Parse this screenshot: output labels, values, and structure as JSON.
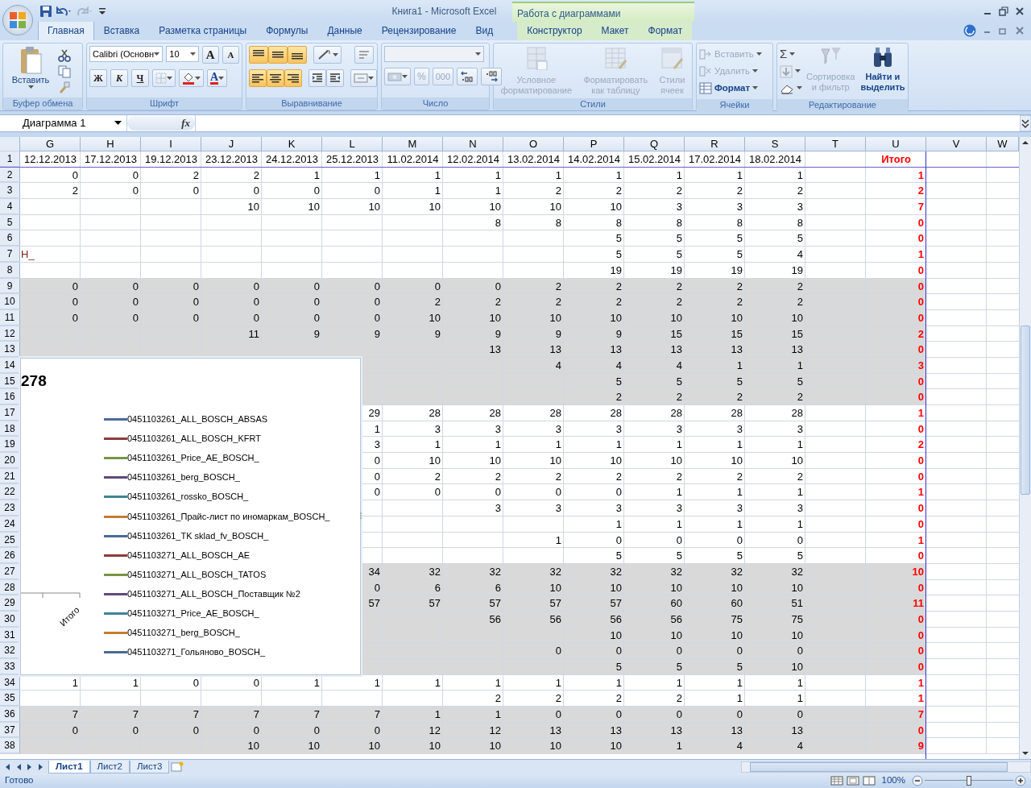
{
  "window": {
    "title": "Книга1 - Microsoft Excel",
    "context_title": "Работа с диаграммами"
  },
  "quick_access": [
    {
      "kind": "save",
      "disabled": false
    },
    {
      "kind": "undo",
      "disabled": false
    },
    {
      "kind": "redo",
      "disabled": true
    }
  ],
  "tabs": [
    {
      "label": "Главная",
      "selected": true,
      "context": false
    },
    {
      "label": "Вставка",
      "selected": false,
      "context": false
    },
    {
      "label": "Разметка страницы",
      "selected": false,
      "context": false
    },
    {
      "label": "Формулы",
      "selected": false,
      "context": false
    },
    {
      "label": "Данные",
      "selected": false,
      "context": false
    },
    {
      "label": "Рецензирование",
      "selected": false,
      "context": false
    },
    {
      "label": "Вид",
      "selected": false,
      "context": false
    },
    {
      "label": "Конструктор",
      "selected": false,
      "context": true
    },
    {
      "label": "Макет",
      "selected": false,
      "context": true
    },
    {
      "label": "Формат",
      "selected": false,
      "context": true
    }
  ],
  "ribbon": {
    "clipboard": {
      "label": "Буфер обмена",
      "paste": "Вставить"
    },
    "font": {
      "label": "Шрифт",
      "name": "Calibri (Основн",
      "size": "10",
      "grow": "A",
      "shrink": "A",
      "bold": "Ж",
      "italic": "К",
      "underline": "Ч",
      "color_letter": "A"
    },
    "alignment": {
      "label": "Выравнивание",
      "buttons": [
        {
          "kind": "top",
          "on": true
        },
        {
          "kind": "middle",
          "on": true
        },
        {
          "kind": "bottom",
          "on": true
        },
        {
          "kind": "left",
          "on": true
        },
        {
          "kind": "center",
          "on": true
        },
        {
          "kind": "right",
          "on": true
        }
      ]
    },
    "number": {
      "label": "Число",
      "percent": "%",
      "thousands": "000"
    },
    "styles": {
      "label": "Стили",
      "buttons": [
        {
          "kind": "conditional",
          "lines": [
            "Условное",
            "форматирование"
          ],
          "disabled": true
        },
        {
          "kind": "table",
          "lines": [
            "Форматировать",
            "как таблицу"
          ],
          "disabled": true
        },
        {
          "kind": "cellstyles",
          "lines": [
            "Стили",
            "ячеек"
          ],
          "disabled": true
        }
      ]
    },
    "cells": {
      "label": "Ячейки",
      "buttons": [
        {
          "kind": "insert",
          "label": "Вставить",
          "disabled": true
        },
        {
          "kind": "delete",
          "label": "Удалить",
          "disabled": true
        },
        {
          "kind": "format",
          "label": "Формат",
          "disabled": false
        }
      ]
    },
    "editing": {
      "label": "Редактирование",
      "sum": "Σ",
      "buttons": [
        {
          "kind": "sort",
          "lines": [
            "Сортировка",
            "и фильтр"
          ],
          "disabled": true
        },
        {
          "kind": "find",
          "lines": [
            "Найти и",
            "выделить"
          ],
          "disabled": false
        }
      ]
    }
  },
  "formula_bar": {
    "name_box": "Диаграмма 1",
    "function_label": "fx"
  },
  "sheet": {
    "columns": [
      {
        "label": "G",
        "kind": "data"
      },
      {
        "label": "H",
        "kind": "data"
      },
      {
        "label": "I",
        "kind": "data"
      },
      {
        "label": "J",
        "kind": "data"
      },
      {
        "label": "K",
        "kind": "data"
      },
      {
        "label": "L",
        "kind": "data"
      },
      {
        "label": "M",
        "kind": "data"
      },
      {
        "label": "N",
        "kind": "data"
      },
      {
        "label": "O",
        "kind": "data"
      },
      {
        "label": "P",
        "kind": "data"
      },
      {
        "label": "Q",
        "kind": "data"
      },
      {
        "label": "R",
        "kind": "data"
      },
      {
        "label": "S",
        "kind": "data"
      },
      {
        "label": "T",
        "kind": "data"
      },
      {
        "label": "U",
        "kind": "total"
      },
      {
        "label": "V",
        "kind": "data"
      },
      {
        "label": "W",
        "kind": "partial"
      }
    ],
    "rows": [
      {
        "number": "1",
        "kind": "dates",
        "shaded": false,
        "cells": [
          "12.12.2013",
          "17.12.2013",
          "19.12.2013",
          "23.12.2013",
          "24.12.2013",
          "25.12.2013",
          "11.02.2014",
          "12.02.2014",
          "13.02.2014",
          "14.02.2014",
          "15.02.2014",
          "17.02.2014",
          "18.02.2014",
          null,
          "Итого"
        ]
      },
      {
        "number": "2",
        "kind": "data",
        "shaded": false,
        "cells": [
          "0",
          "0",
          "2",
          "2",
          "1",
          "1",
          "1",
          "1",
          "1",
          "1",
          "1",
          "1",
          "1",
          null,
          "1"
        ]
      },
      {
        "number": "3",
        "kind": "data",
        "shaded": false,
        "cells": [
          "2",
          "0",
          "0",
          "0",
          "0",
          "0",
          "1",
          "1",
          "2",
          "2",
          "2",
          "2",
          "2",
          null,
          "2"
        ]
      },
      {
        "number": "4",
        "kind": "data",
        "shaded": false,
        "cells": [
          null,
          null,
          null,
          "10",
          "10",
          "10",
          "10",
          "10",
          "10",
          "10",
          "3",
          "3",
          "3",
          null,
          "7"
        ]
      },
      {
        "number": "5",
        "kind": "data",
        "shaded": false,
        "cells": [
          null,
          null,
          null,
          null,
          null,
          null,
          null,
          "8",
          "8",
          "8",
          "8",
          "8",
          "8",
          null,
          "0"
        ]
      },
      {
        "number": "6",
        "kind": "data",
        "shaded": false,
        "cells": [
          null,
          null,
          null,
          null,
          null,
          null,
          null,
          null,
          null,
          "5",
          "5",
          "5",
          "5",
          null,
          "0"
        ]
      },
      {
        "number": "7",
        "kind": "data",
        "shaded": false,
        "cells": [
          {
            "text": "Н_",
            "kind": "text"
          },
          null,
          null,
          null,
          null,
          null,
          null,
          null,
          null,
          "5",
          "5",
          "5",
          "4",
          null,
          "1"
        ]
      },
      {
        "number": "8",
        "kind": "data",
        "shaded": false,
        "cells": [
          null,
          null,
          null,
          null,
          null,
          null,
          null,
          null,
          null,
          "19",
          "19",
          "19",
          "19",
          null,
          "0"
        ]
      },
      {
        "number": "9",
        "kind": "data",
        "shaded": true,
        "cells": [
          "0",
          "0",
          "0",
          "0",
          "0",
          "0",
          "0",
          "0",
          "2",
          "2",
          "2",
          "2",
          "2",
          null,
          "0"
        ]
      },
      {
        "number": "10",
        "kind": "data",
        "shaded": true,
        "cells": [
          "0",
          "0",
          "0",
          "0",
          "0",
          "0",
          "2",
          "2",
          "2",
          "2",
          "2",
          "2",
          "2",
          null,
          "0"
        ]
      },
      {
        "number": "11",
        "kind": "data",
        "shaded": true,
        "cells": [
          "0",
          "0",
          "0",
          "0",
          "0",
          "0",
          "10",
          "10",
          "10",
          "10",
          "10",
          "10",
          "10",
          null,
          "0"
        ]
      },
      {
        "number": "12",
        "kind": "data",
        "shaded": true,
        "cells": [
          null,
          null,
          null,
          "11",
          "9",
          "9",
          "9",
          "9",
          "9",
          "9",
          "15",
          "15",
          "15",
          null,
          "2"
        ]
      },
      {
        "number": "13",
        "kind": "data",
        "shaded": true,
        "cells": [
          null,
          null,
          null,
          null,
          null,
          null,
          null,
          "13",
          "13",
          "13",
          "13",
          "13",
          "13",
          null,
          "0"
        ]
      },
      {
        "number": "14",
        "kind": "data",
        "shaded": true,
        "cells": [
          null,
          null,
          null,
          null,
          null,
          null,
          null,
          null,
          "4",
          "4",
          "4",
          "1",
          "1",
          null,
          "3"
        ]
      },
      {
        "number": "15",
        "kind": "data",
        "shaded": true,
        "cells": [
          null,
          null,
          null,
          null,
          null,
          null,
          null,
          null,
          null,
          "5",
          "5",
          "5",
          "5",
          null,
          "0"
        ]
      },
      {
        "number": "16",
        "kind": "data",
        "shaded": true,
        "cells": [
          null,
          null,
          null,
          null,
          null,
          null,
          null,
          null,
          null,
          "2",
          "2",
          "2",
          "2",
          null,
          "0"
        ]
      },
      {
        "number": "17",
        "kind": "data",
        "shaded": false,
        "cells": [
          null,
          null,
          null,
          null,
          null,
          "29",
          "28",
          "28",
          "28",
          "28",
          "28",
          "28",
          "28",
          null,
          "1"
        ]
      },
      {
        "number": "18",
        "kind": "data",
        "shaded": false,
        "cells": [
          null,
          null,
          null,
          null,
          null,
          "1",
          "3",
          "3",
          "3",
          "3",
          "3",
          "3",
          "3",
          null,
          "0"
        ]
      },
      {
        "number": "19",
        "kind": "data",
        "shaded": false,
        "cells": [
          null,
          null,
          null,
          null,
          null,
          "3",
          "1",
          "1",
          "1",
          "1",
          "1",
          "1",
          "1",
          null,
          "2"
        ]
      },
      {
        "number": "20",
        "kind": "data",
        "shaded": false,
        "cells": [
          null,
          null,
          null,
          null,
          null,
          "0",
          "10",
          "10",
          "10",
          "10",
          "10",
          "10",
          "10",
          null,
          "0"
        ]
      },
      {
        "number": "21",
        "kind": "data",
        "shaded": false,
        "cells": [
          null,
          null,
          null,
          null,
          null,
          "0",
          "2",
          "2",
          "2",
          "2",
          "2",
          "2",
          "2",
          null,
          "0"
        ]
      },
      {
        "number": "22",
        "kind": "data",
        "shaded": false,
        "cells": [
          null,
          null,
          null,
          null,
          null,
          "0",
          "0",
          "0",
          "0",
          "0",
          "1",
          "1",
          "1",
          null,
          "1"
        ]
      },
      {
        "number": "23",
        "kind": "data",
        "shaded": false,
        "cells": [
          null,
          null,
          null,
          null,
          null,
          null,
          null,
          "3",
          "3",
          "3",
          "3",
          "3",
          "3",
          null,
          "0"
        ]
      },
      {
        "number": "24",
        "kind": "data",
        "shaded": false,
        "cells": [
          null,
          null,
          null,
          null,
          null,
          null,
          null,
          null,
          null,
          "1",
          "1",
          "1",
          "1",
          null,
          "0"
        ]
      },
      {
        "number": "25",
        "kind": "data",
        "shaded": false,
        "cells": [
          null,
          null,
          null,
          null,
          null,
          null,
          null,
          null,
          "1",
          "0",
          "0",
          "0",
          "0",
          null,
          "1"
        ]
      },
      {
        "number": "26",
        "kind": "data",
        "shaded": false,
        "cells": [
          null,
          null,
          null,
          null,
          null,
          null,
          null,
          null,
          null,
          "5",
          "5",
          "5",
          "5",
          null,
          "0"
        ]
      },
      {
        "number": "27",
        "kind": "data",
        "shaded": true,
        "cells": [
          null,
          null,
          null,
          null,
          null,
          "34",
          "32",
          "32",
          "32",
          "32",
          "32",
          "32",
          "32",
          null,
          "10"
        ]
      },
      {
        "number": "28",
        "kind": "data",
        "shaded": true,
        "cells": [
          null,
          null,
          null,
          null,
          null,
          "0",
          "6",
          "6",
          "10",
          "10",
          "10",
          "10",
          "10",
          null,
          "0"
        ]
      },
      {
        "number": "29",
        "kind": "data",
        "shaded": true,
        "cells": [
          null,
          null,
          null,
          null,
          null,
          "57",
          "57",
          "57",
          "57",
          "57",
          "60",
          "60",
          "51",
          null,
          "11"
        ]
      },
      {
        "number": "30",
        "kind": "data",
        "shaded": true,
        "cells": [
          null,
          null,
          null,
          null,
          null,
          null,
          null,
          "56",
          "56",
          "56",
          "56",
          "75",
          "75",
          null,
          "0"
        ]
      },
      {
        "number": "31",
        "kind": "data",
        "shaded": true,
        "cells": [
          null,
          null,
          null,
          null,
          null,
          null,
          null,
          null,
          null,
          "10",
          "10",
          "10",
          "10",
          null,
          "0"
        ]
      },
      {
        "number": "32",
        "kind": "data",
        "shaded": true,
        "cells": [
          null,
          null,
          null,
          null,
          null,
          null,
          null,
          null,
          "0",
          "0",
          "0",
          "0",
          "0",
          null,
          "0"
        ]
      },
      {
        "number": "33",
        "kind": "data",
        "shaded": true,
        "cells": [
          null,
          null,
          null,
          null,
          null,
          null,
          null,
          null,
          null,
          "5",
          "5",
          "5",
          "10",
          null,
          "0"
        ]
      },
      {
        "number": "34",
        "kind": "data",
        "shaded": false,
        "cells": [
          "1",
          "1",
          "0",
          "0",
          "1",
          "1",
          "1",
          "1",
          "1",
          "1",
          "1",
          "1",
          "1",
          null,
          "1"
        ]
      },
      {
        "number": "35",
        "kind": "data",
        "shaded": false,
        "cells": [
          null,
          null,
          null,
          null,
          null,
          null,
          null,
          "2",
          "2",
          "2",
          "2",
          "1",
          "1",
          null,
          "1"
        ]
      },
      {
        "number": "36",
        "kind": "data",
        "shaded": true,
        "cells": [
          "7",
          "7",
          "7",
          "7",
          "7",
          "7",
          "1",
          "1",
          "0",
          "0",
          "0",
          "0",
          "0",
          null,
          "7"
        ]
      },
      {
        "number": "37",
        "kind": "data",
        "shaded": true,
        "cells": [
          "0",
          "0",
          "0",
          "0",
          "0",
          "0",
          "12",
          "12",
          "13",
          "13",
          "13",
          "13",
          "13",
          null,
          "0"
        ]
      },
      {
        "number": "38",
        "kind": "data",
        "shaded": true,
        "cells": [
          null,
          null,
          null,
          "10",
          "10",
          "10",
          "10",
          "10",
          "10",
          "10",
          "1",
          "4",
          "4",
          null,
          "9"
        ]
      }
    ]
  },
  "chart": {
    "title_fragment": "278",
    "axis_label": "Итого",
    "legend": [
      {
        "label": "0451103261_ALL_BOSCH_ABSAS",
        "color": "#4a6b97"
      },
      {
        "label": "0451103261_ALL_BOSCH_KFRT",
        "color": "#8e3b3a"
      },
      {
        "label": "0451103261_Price_AE_BOSCH_",
        "color": "#7a9443"
      },
      {
        "label": "0451103261_berg_BOSCH_",
        "color": "#5e4a7d"
      },
      {
        "label": "0451103261_rossko_BOSCH_",
        "color": "#3d8594"
      },
      {
        "label": "0451103261_Прайс-лист по иномаркам_BOSCH_",
        "color": "#c77b34"
      },
      {
        "label": "0451103261_TK sklad_fv_BOSCH_",
        "color": "#4a6b97"
      },
      {
        "label": "0451103271_ALL_BOSCH_AE",
        "color": "#8e3b3a"
      },
      {
        "label": "0451103271_ALL_BOSCH_TATOS",
        "color": "#7a9443"
      },
      {
        "label": "0451103271_ALL_BOSCH_Поставщик №2",
        "color": "#5e4a7d"
      },
      {
        "label": "0451103271_Price_AE_BOSCH_",
        "color": "#3d8594"
      },
      {
        "label": "0451103271_berg_BOSCH_",
        "color": "#c77b34"
      },
      {
        "label": "0451103271_Гольяново_BOSCH_",
        "color": "#4a6b97"
      }
    ]
  },
  "sheet_tabs": [
    {
      "label": "Лист1",
      "selected": true
    },
    {
      "label": "Лист2",
      "selected": false
    },
    {
      "label": "Лист3",
      "selected": false
    }
  ],
  "status_bar": {
    "text": "Готово",
    "zoom": "100%",
    "zoom_slider": {
      "level": 0.5
    }
  }
}
